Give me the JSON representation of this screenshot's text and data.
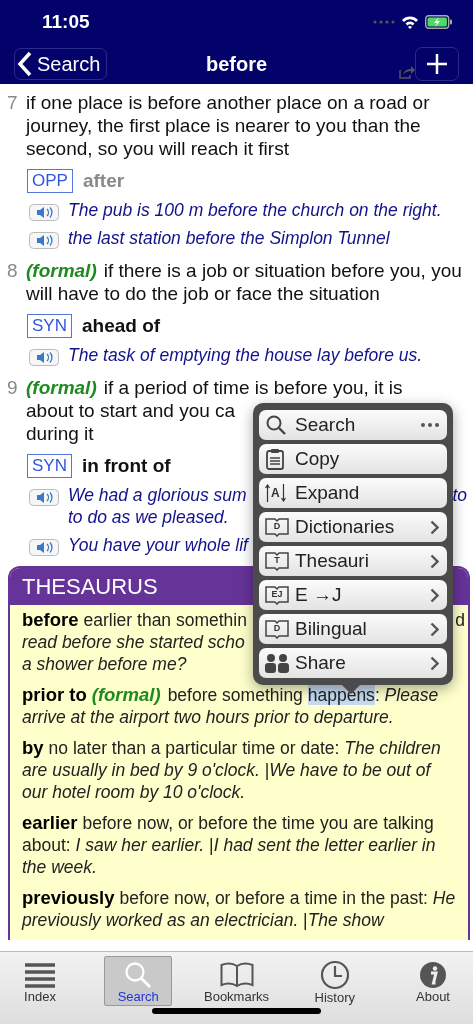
{
  "status_bar": {
    "time": "11:05"
  },
  "nav": {
    "back": "Search",
    "title": "before"
  },
  "senses": [
    {
      "number": "7",
      "definition": [
        [
          "if one place is before another place on a road or journey, the first place is nearer to you than the second, so you will reach it first"
        ]
      ],
      "relations": [
        {
          "kind": "opp",
          "tag": "OPP",
          "word": "after"
        }
      ],
      "examples": [
        [
          [
            "The pub is 100 m before the church on the right."
          ]
        ],
        [
          [
            "the last station before the Simplon Tunnel"
          ]
        ]
      ]
    },
    {
      "number": "8",
      "register": "(formal)",
      "definition": [
        [
          "if there is a job or situation before you, you will have to do the job or face the situation"
        ]
      ],
      "relations": [
        {
          "kind": "syn",
          "tag": "SYN",
          "word": "ahead of"
        }
      ],
      "examples": [
        [
          [
            "The task of emptying the house lay before us."
          ]
        ]
      ]
    },
    {
      "number": "9",
      "register": "(formal)",
      "definition": [
        [
          "if a period of time is before you, it is"
        ],
        [
          "about to start and you ca"
        ],
        [
          "during it"
        ]
      ],
      "relations": [
        {
          "kind": "syn",
          "tag": "SYN",
          "word": "in front of"
        }
      ],
      "examples": [
        [
          [
            "We had a glorious sum",
            "to"
          ],
          [
            "to do as we pleased."
          ]
        ],
        [
          [
            "You have your whole lif"
          ]
        ]
      ]
    }
  ],
  "thesaurus": {
    "title": "THESAURUS",
    "entries": [
      {
        "head": "before",
        "lines": [
          [
            "earlier than somethin",
            "d"
          ],
          [
            "*read before she started scho*"
          ],
          [
            "*a shower before me?*"
          ]
        ]
      },
      {
        "head": "prior to",
        "register": "(formal)",
        "parts": [
          {
            "text": "before something ",
            "selected": false
          },
          {
            "text": "happens",
            "selected": true
          },
          {
            "text": ": *Please arrive at the airport two hours prior to departure.*",
            "selected": false
          }
        ]
      },
      {
        "head": "by",
        "parts": [
          {
            "text": "no later than a particular time or date: *The children are usually in bed by 9 o'clock.* |*We have to be out of our hotel room by 10 o'clock.*",
            "selected": false
          }
        ]
      },
      {
        "head": "earlier",
        "parts": [
          {
            "text": "before now, or before the time you are talking about: *I saw her earlier.* |*I had sent the letter earlier in the week.*",
            "selected": false
          }
        ]
      },
      {
        "head": "previously",
        "parts": [
          {
            "text": "before now, or before a time in the past: *He previously worked as an electrician.* |*The show*",
            "selected": false
          }
        ]
      }
    ]
  },
  "menu": {
    "items": [
      {
        "kind": "search",
        "label": "Search",
        "more": true,
        "submenu": false
      },
      {
        "kind": "copy",
        "label": "Copy",
        "more": false,
        "submenu": false
      },
      {
        "kind": "expand",
        "label": "Expand",
        "glyph": "A",
        "more": false,
        "submenu": false
      },
      {
        "kind": "book",
        "label": "Dictionaries",
        "glyph": "D",
        "more": false,
        "submenu": true
      },
      {
        "kind": "book",
        "label": "Thesauri",
        "glyph": "T",
        "more": false,
        "submenu": true
      },
      {
        "kind": "book",
        "label": "E →J",
        "glyph": "EJ",
        "more": false,
        "submenu": true
      },
      {
        "kind": "book",
        "label": "Bilingual",
        "glyph": "D",
        "more": false,
        "submenu": true
      },
      {
        "kind": "share",
        "label": "Share",
        "more": false,
        "submenu": true
      }
    ]
  },
  "tabs": [
    {
      "kind": "index",
      "label": "Index",
      "selected": false
    },
    {
      "kind": "search",
      "label": "Search",
      "selected": true
    },
    {
      "kind": "bookmarks",
      "label": "Bookmarks",
      "selected": false
    },
    {
      "kind": "history",
      "label": "History",
      "selected": false
    },
    {
      "kind": "about",
      "label": "About",
      "selected": false
    }
  ]
}
